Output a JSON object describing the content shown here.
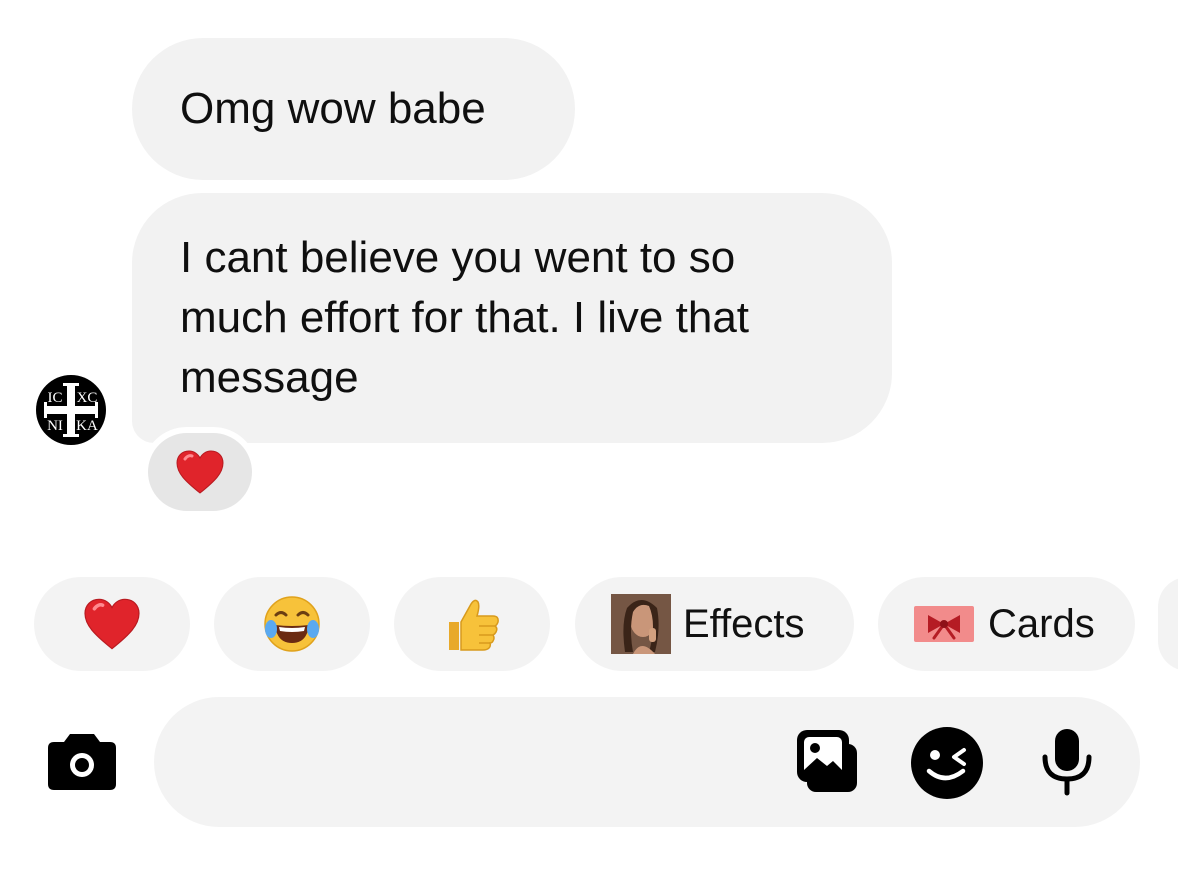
{
  "messages": [
    {
      "text": "Omg wow babe"
    },
    {
      "text": "I cant believe you went to so much effort for that. I live that message"
    }
  ],
  "avatar": {
    "icon": "icxc-nika-cross-icon",
    "top_left": "IC",
    "top_right": "XC",
    "bottom_left": "NI",
    "bottom_right": "KA"
  },
  "message_reaction": {
    "emoji": "heart",
    "color": "#e0242b"
  },
  "quick_reactions": [
    {
      "icon": "red-heart-icon"
    },
    {
      "icon": "laughing-tears-icon"
    },
    {
      "icon": "thumbs-up-icon"
    }
  ],
  "actions": {
    "effects_label": "Effects",
    "cards_label": "Cards"
  },
  "composer": {
    "icons": [
      "camera-icon",
      "gallery-icon",
      "sticker-icon",
      "microphone-icon"
    ]
  },
  "colors": {
    "bubble": "#f2f2f2",
    "chip": "#f3f3f3",
    "heart": "#e0242b",
    "emoji_yellow": "#f7c23a"
  }
}
